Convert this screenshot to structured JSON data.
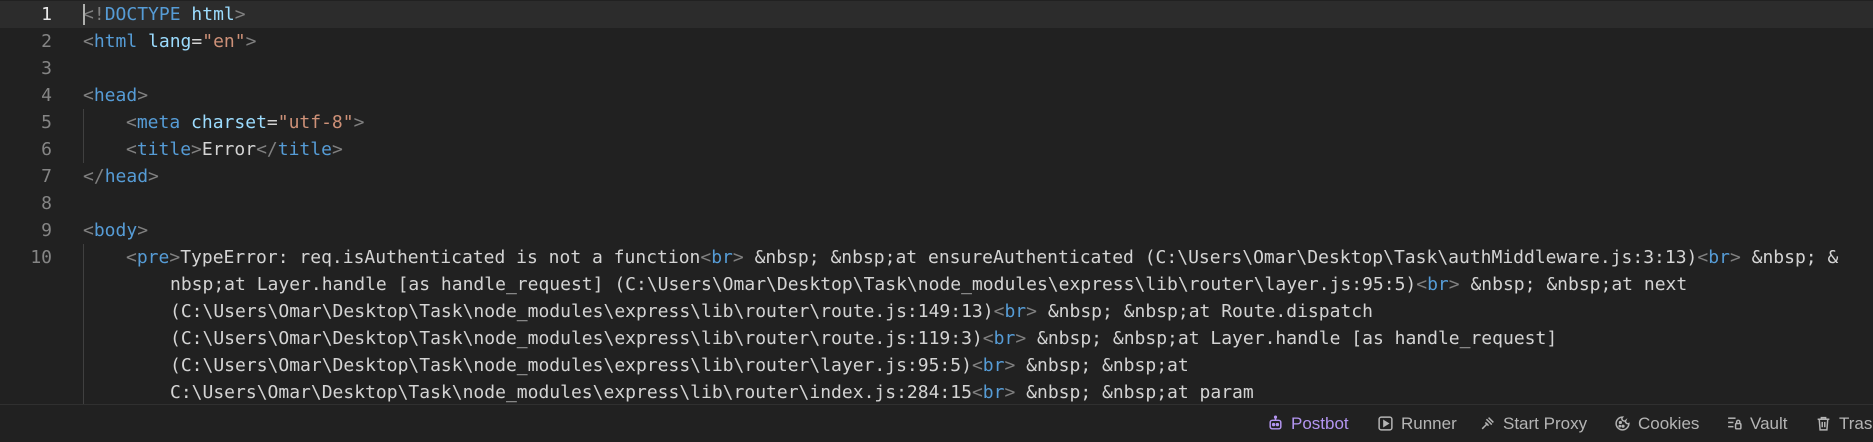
{
  "editor": {
    "active_line": 1,
    "lines": [
      {
        "num": "1",
        "indent": 0,
        "tokens": [
          {
            "k": "punc",
            "t": "<!"
          },
          {
            "k": "tag",
            "t": "DOCTYPE"
          },
          {
            "k": "text",
            "t": " "
          },
          {
            "k": "attr",
            "t": "html"
          },
          {
            "k": "punc",
            "t": ">"
          }
        ]
      },
      {
        "num": "2",
        "indent": 0,
        "tokens": [
          {
            "k": "punc",
            "t": "<"
          },
          {
            "k": "tag",
            "t": "html"
          },
          {
            "k": "text",
            "t": " "
          },
          {
            "k": "attr",
            "t": "lang"
          },
          {
            "k": "text",
            "t": "="
          },
          {
            "k": "str",
            "t": "\"en\""
          },
          {
            "k": "punc",
            "t": ">"
          }
        ]
      },
      {
        "num": "3",
        "indent": 0,
        "tokens": []
      },
      {
        "num": "4",
        "indent": 0,
        "tokens": [
          {
            "k": "punc",
            "t": "<"
          },
          {
            "k": "tag",
            "t": "head"
          },
          {
            "k": "punc",
            "t": ">"
          }
        ]
      },
      {
        "num": "5",
        "indent": 1,
        "tokens": [
          {
            "k": "punc",
            "t": "<"
          },
          {
            "k": "tag",
            "t": "meta"
          },
          {
            "k": "text",
            "t": " "
          },
          {
            "k": "attr",
            "t": "charset"
          },
          {
            "k": "text",
            "t": "="
          },
          {
            "k": "str",
            "t": "\"utf-8\""
          },
          {
            "k": "punc",
            "t": ">"
          }
        ]
      },
      {
        "num": "6",
        "indent": 1,
        "tokens": [
          {
            "k": "punc",
            "t": "<"
          },
          {
            "k": "tag",
            "t": "title"
          },
          {
            "k": "punc",
            "t": ">"
          },
          {
            "k": "text",
            "t": "Error"
          },
          {
            "k": "punc",
            "t": "</"
          },
          {
            "k": "tag",
            "t": "title"
          },
          {
            "k": "punc",
            "t": ">"
          }
        ]
      },
      {
        "num": "7",
        "indent": 0,
        "tokens": [
          {
            "k": "punc",
            "t": "</"
          },
          {
            "k": "tag",
            "t": "head"
          },
          {
            "k": "punc",
            "t": ">"
          }
        ]
      },
      {
        "num": "8",
        "indent": 0,
        "tokens": []
      },
      {
        "num": "9",
        "indent": 0,
        "tokens": [
          {
            "k": "punc",
            "t": "<"
          },
          {
            "k": "tag",
            "t": "body"
          },
          {
            "k": "punc",
            "t": ">"
          }
        ]
      },
      {
        "num": "10",
        "indent": 1,
        "tokens": [
          {
            "k": "punc",
            "t": "<"
          },
          {
            "k": "tag",
            "t": "pre"
          },
          {
            "k": "punc",
            "t": ">"
          },
          {
            "k": "text",
            "t": "TypeError: req.isAuthenticated is not a function"
          },
          {
            "k": "punc",
            "t": "<"
          },
          {
            "k": "tag",
            "t": "br"
          },
          {
            "k": "punc",
            "t": ">"
          },
          {
            "k": "text",
            "t": " &nbsp; &nbsp;at ensureAuthenticated (C:\\Users\\Omar\\Desktop\\Task\\authMiddleware.js:3:13)"
          },
          {
            "k": "punc",
            "t": "<"
          },
          {
            "k": "tag",
            "t": "br"
          },
          {
            "k": "punc",
            "t": ">"
          },
          {
            "k": "text",
            "t": " &nbsp; &"
          }
        ]
      },
      {
        "num": "",
        "indent": 2,
        "tokens": [
          {
            "k": "text",
            "t": "nbsp;at Layer.handle [as handle_request] (C:\\Users\\Omar\\Desktop\\Task\\node_modules\\express\\lib\\router\\layer.js:95:5)"
          },
          {
            "k": "punc",
            "t": "<"
          },
          {
            "k": "tag",
            "t": "br"
          },
          {
            "k": "punc",
            "t": ">"
          },
          {
            "k": "text",
            "t": " &nbsp; &nbsp;at next"
          }
        ]
      },
      {
        "num": "",
        "indent": 2,
        "tokens": [
          {
            "k": "text",
            "t": "(C:\\Users\\Omar\\Desktop\\Task\\node_modules\\express\\lib\\router\\route.js:149:13)"
          },
          {
            "k": "punc",
            "t": "<"
          },
          {
            "k": "tag",
            "t": "br"
          },
          {
            "k": "punc",
            "t": ">"
          },
          {
            "k": "text",
            "t": " &nbsp; &nbsp;at Route.dispatch"
          }
        ]
      },
      {
        "num": "",
        "indent": 2,
        "tokens": [
          {
            "k": "text",
            "t": "(C:\\Users\\Omar\\Desktop\\Task\\node_modules\\express\\lib\\router\\route.js:119:3)"
          },
          {
            "k": "punc",
            "t": "<"
          },
          {
            "k": "tag",
            "t": "br"
          },
          {
            "k": "punc",
            "t": ">"
          },
          {
            "k": "text",
            "t": " &nbsp; &nbsp;at Layer.handle [as handle_request]"
          }
        ]
      },
      {
        "num": "",
        "indent": 2,
        "tokens": [
          {
            "k": "text",
            "t": "(C:\\Users\\Omar\\Desktop\\Task\\node_modules\\express\\lib\\router\\layer.js:95:5)"
          },
          {
            "k": "punc",
            "t": "<"
          },
          {
            "k": "tag",
            "t": "br"
          },
          {
            "k": "punc",
            "t": ">"
          },
          {
            "k": "text",
            "t": " &nbsp; &nbsp;at"
          }
        ]
      },
      {
        "num": "",
        "indent": 2,
        "tokens": [
          {
            "k": "text",
            "t": "C:\\Users\\Omar\\Desktop\\Task\\node_modules\\express\\lib\\router\\index.js:284:15"
          },
          {
            "k": "punc",
            "t": "<"
          },
          {
            "k": "tag",
            "t": "br"
          },
          {
            "k": "punc",
            "t": ">"
          },
          {
            "k": "text",
            "t": " &nbsp; &nbsp;at param"
          }
        ]
      }
    ]
  },
  "statusbar": {
    "items": [
      {
        "id": "postbot",
        "label": "Postbot",
        "icon": "postbot-icon",
        "accent": true
      },
      {
        "id": "runner",
        "label": "Runner",
        "icon": "runner-icon",
        "accent": false
      },
      {
        "id": "start-proxy",
        "label": "Start Proxy",
        "icon": "proxy-icon",
        "accent": false
      },
      {
        "id": "cookies",
        "label": "Cookies",
        "icon": "cookie-icon",
        "accent": false
      },
      {
        "id": "vault",
        "label": "Vault",
        "icon": "vault-icon",
        "accent": false
      },
      {
        "id": "trash",
        "label": "Trash",
        "icon": "trash-icon",
        "accent": false
      }
    ]
  },
  "colors": {
    "background": "#212121",
    "tag": "#569cd6",
    "attribute": "#9cdcfe",
    "string": "#ce9178",
    "text": "#d4d4d4",
    "punctuation": "#808080",
    "accent": "#b395f0"
  }
}
